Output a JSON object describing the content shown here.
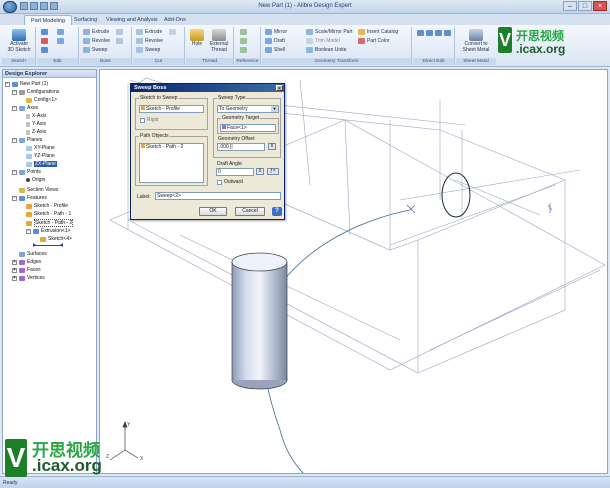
{
  "window": {
    "title": "New Part (1) - Alibre Design Expert"
  },
  "tabs": [
    "Part Modeling",
    "Surfacing",
    "Viewing and Analysis",
    "Add-Ons"
  ],
  "ribbon": {
    "sketch": {
      "label": "Sketch",
      "activate": "Activate",
      "activate2": "3D Sketch"
    },
    "edit": {
      "label": "Edit"
    },
    "boss": {
      "label": "Boss",
      "items": [
        "Extrude",
        "Revolve",
        "Sweep"
      ]
    },
    "cut": {
      "label": "Cut",
      "items": [
        "Extrude",
        "Revolve",
        "Sweep"
      ]
    },
    "thread": {
      "label": "Thread",
      "hole": "Hole",
      "external": "External",
      "thread_word": "Thread"
    },
    "reference": {
      "label": "Reference"
    },
    "geometry": {
      "label": "Geometry Transform",
      "items": [
        "Mirror",
        "Draft",
        "Shell",
        "Scale/Mirror Part",
        "Trim Model",
        "Boolean Unite",
        "Insert Catalog",
        "Part Color"
      ]
    },
    "directedit": {
      "label": "Direct Edit"
    },
    "sheetmetal": {
      "label": "Sheet Metal",
      "convert": "Convert to",
      "convert2": "Sheet Metal"
    }
  },
  "explorer": {
    "header": "Design Explorer",
    "items": [
      "New Part (1)",
      "Configurations",
      "Config<1>",
      "Axes",
      "X-Axis",
      "Y-Axis",
      "Z-Axis",
      "Planes",
      "XY-Plane",
      "YZ-Plane",
      "ZX-Plane",
      "Points",
      "Origin",
      "Section Views",
      "Features",
      "Sketch - Profile",
      "Sketch - Path - 1",
      "Sketch - Path - 2",
      "Extrusion<1>",
      "Sketch<4>",
      "Surfaces",
      "Edges",
      "Faces",
      "Vertices"
    ]
  },
  "dialog": {
    "title": "Sweep Boss",
    "sketch_to_sweep_label": "Sketch to Sweep",
    "sketch_to_sweep_value": "Sketch - Profile",
    "rigid_label": "Rigid",
    "path_objects_label": "Path Objects",
    "path_objects_value": "Sketch - Path - 2",
    "sweep_type_label": "Sweep Type",
    "sweep_type_value": "To Geometry",
    "geometry_target_label": "Geometry Target",
    "geometry_target_value": "Face<1>",
    "geometry_offset_label": "Geometry Offset",
    "geometry_offset_value": ".000 ||",
    "draft_angle_label": "Draft Angle",
    "draft_angle_value": "0",
    "outward_label": "Outward",
    "label_label": "Label:",
    "label_value": "Sweep<2>",
    "ok": "OK",
    "cancel": "Cancel",
    "help": "?"
  },
  "watermark": {
    "cn": "开思视频",
    "url": ".icax.org",
    "v": "V"
  },
  "status": {
    "text": "Ready"
  }
}
